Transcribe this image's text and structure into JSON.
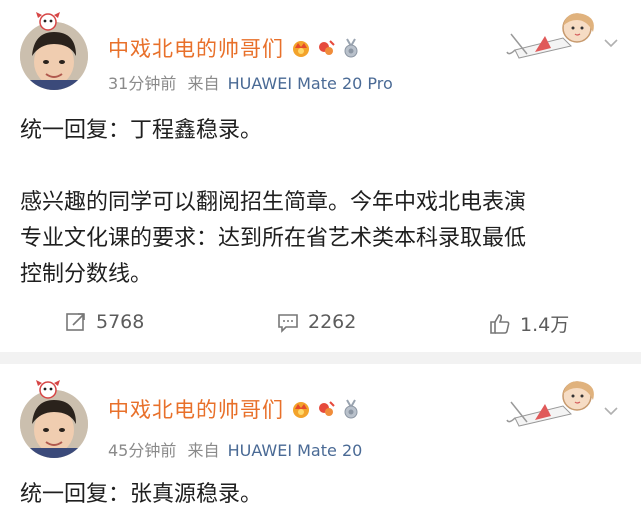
{
  "posts": [
    {
      "username": "中戏北电的帅哥们",
      "time": "31分钟前",
      "source_prefix": "来自",
      "device": "HUAWEI Mate 20 Pro",
      "content": [
        "统一回复：丁程鑫稳录。",
        "",
        "感兴趣的同学可以翻阅招生简章。今年中戏北电表演",
        "专业文化课的要求：达到所在省艺术类本科录取最低",
        "控制分数线。"
      ],
      "reposts": "5768",
      "comments": "2262",
      "likes": "1.4万"
    },
    {
      "username": "中戏北电的帅哥们",
      "time": "45分钟前",
      "source_prefix": "来自",
      "device": "HUAWEI Mate 20",
      "content": [
        "统一回复：张真源稳录。"
      ]
    }
  ],
  "colors": {
    "username": "#e8702a",
    "device": "#4a6a95",
    "meta": "#8a8a8a",
    "background": "#f2f2f2"
  },
  "icons": [
    "repost-icon",
    "comment-icon",
    "like-icon",
    "chevron-down-icon",
    "crown-badge-icon",
    "fan-badge-icon",
    "medal-badge-icon"
  ]
}
